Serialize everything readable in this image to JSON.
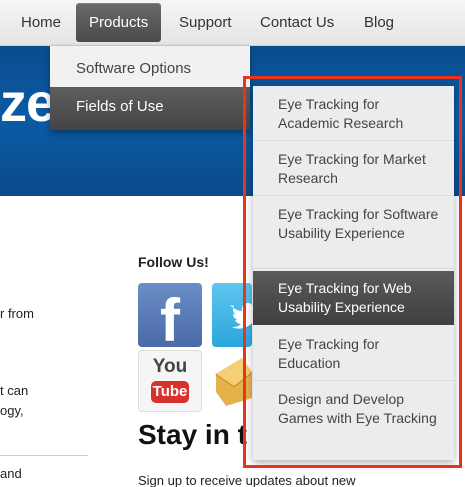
{
  "nav": {
    "items": [
      "Home",
      "Products",
      "Support",
      "Contact Us",
      "Blog"
    ],
    "active": "Products"
  },
  "hero": {
    "text": "ze"
  },
  "products_menu": {
    "items": [
      "Software Options",
      "Fields of Use"
    ],
    "active": "Fields of Use"
  },
  "fields_menu": {
    "items": [
      "Eye Tracking for Academic Research",
      "Eye Tracking for Market Research",
      "Eye Tracking for Software Usability Experience",
      "Eye Tracking for Web Usability Experience",
      "Eye Tracking for Education",
      "Design and Develop Games with Eye Tracking"
    ],
    "active": "Eye Tracking for Web Usability Experience"
  },
  "content": {
    "frag1": "r from",
    "frag2": "t can",
    "frag3": "ogy,",
    "frag4": "and",
    "follow_title": "Follow Us!",
    "stay_heading": "Stay in t",
    "signup_text": "Sign up to receive updates about new"
  },
  "social": [
    "facebook-icon",
    "twitter-icon",
    "youtube-icon",
    "mail-icon"
  ],
  "youtube_icon_text": {
    "you": "You",
    "tube": "Tube"
  },
  "colors": {
    "annotation": "#e8341c",
    "hero": "#0b5aa6",
    "menu_active": "#4a4a4a"
  }
}
